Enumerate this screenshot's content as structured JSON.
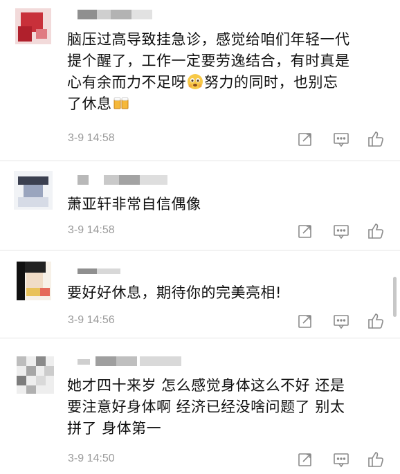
{
  "comments": [
    {
      "text_a": "脑压过高导致挂急诊，感觉给咱们年轻一代\n提个醒了，工作一定要劳逸结合，有时真是\n心有余而力不足呀",
      "text_b": "努力的同时，也别忘\n了休息",
      "emoji_1": "worried-face-emoji",
      "emoji_2": "beer-mugs-emoji",
      "time": "3-9 14:58"
    },
    {
      "text": "萧亚轩非常自信偶像",
      "time": "3-9 14:58"
    },
    {
      "text": "要好好休息，期待你的完美亮相!",
      "time": "3-9 14:56"
    },
    {
      "text": "她才四十来岁 怎么感觉身体这么不好 还是\n要注意好身体啊 经济已经没啥问题了 别太\n拼了 身体第一",
      "time": "3-9 14:50"
    }
  ],
  "actions": [
    "share-icon",
    "reply-icon",
    "like-icon"
  ],
  "colors": {
    "time": "#9a9a9a",
    "icon": "#8a8a8a",
    "divider": "#e4e4e4"
  }
}
